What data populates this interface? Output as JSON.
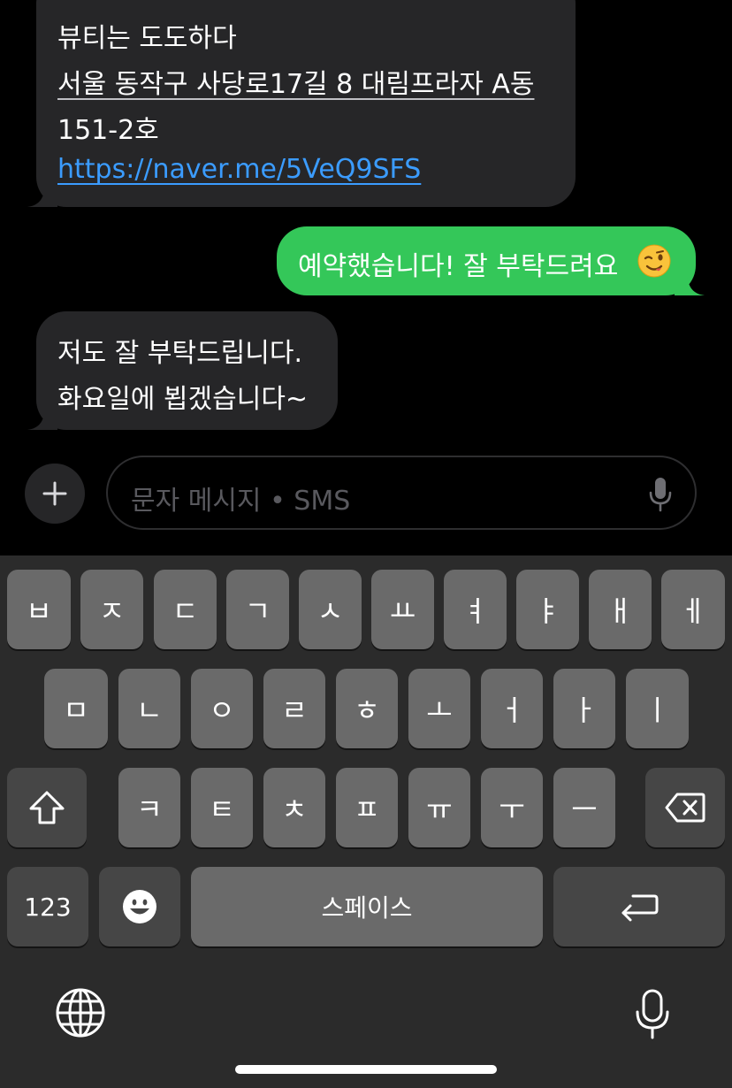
{
  "messages": [
    {
      "direction": "incoming",
      "lines": [
        "뷰티는 도도하다",
        "서울 동작구 사당로17길 8 대림프라자 A동",
        "151-2호",
        "https://naver.me/5VeQ9SFS"
      ]
    },
    {
      "direction": "outgoing",
      "text": "예약했습니다! 잘 부탁드려요",
      "emoji": "winking-face"
    },
    {
      "direction": "incoming",
      "lines": [
        "저도 잘 부탁드립니다.",
        "화요일에 뵙겠습니다~"
      ]
    }
  ],
  "composer": {
    "placeholder": "문자 메시지 • SMS",
    "icons": [
      "plus-icon",
      "microphone-icon"
    ]
  },
  "keyboard": {
    "row1": [
      "ㅂ",
      "ㅈ",
      "ㄷ",
      "ㄱ",
      "ㅅ",
      "ㅛ",
      "ㅕ",
      "ㅑ",
      "ㅐ",
      "ㅔ"
    ],
    "row2": [
      "ㅁ",
      "ㄴ",
      "ㅇ",
      "ㄹ",
      "ㅎ",
      "ㅗ",
      "ㅓ",
      "ㅏ",
      "ㅣ"
    ],
    "row3": [
      "ㅋ",
      "ㅌ",
      "ㅊ",
      "ㅍ",
      "ㅠ",
      "ㅜ",
      "ㅡ"
    ],
    "numbers_label": "123",
    "space_label": "스페이스",
    "icons": [
      "shift-icon",
      "backspace-icon",
      "emoji-icon",
      "return-icon",
      "globe-icon",
      "dictation-icon"
    ]
  },
  "colors": {
    "incoming_bubble": "#262628",
    "outgoing_bubble": "#34c759",
    "link": "#3b9cff",
    "key_light": "#6a6a6a",
    "key_dark": "#464646",
    "keyboard_bg": "#2b2b2b"
  }
}
